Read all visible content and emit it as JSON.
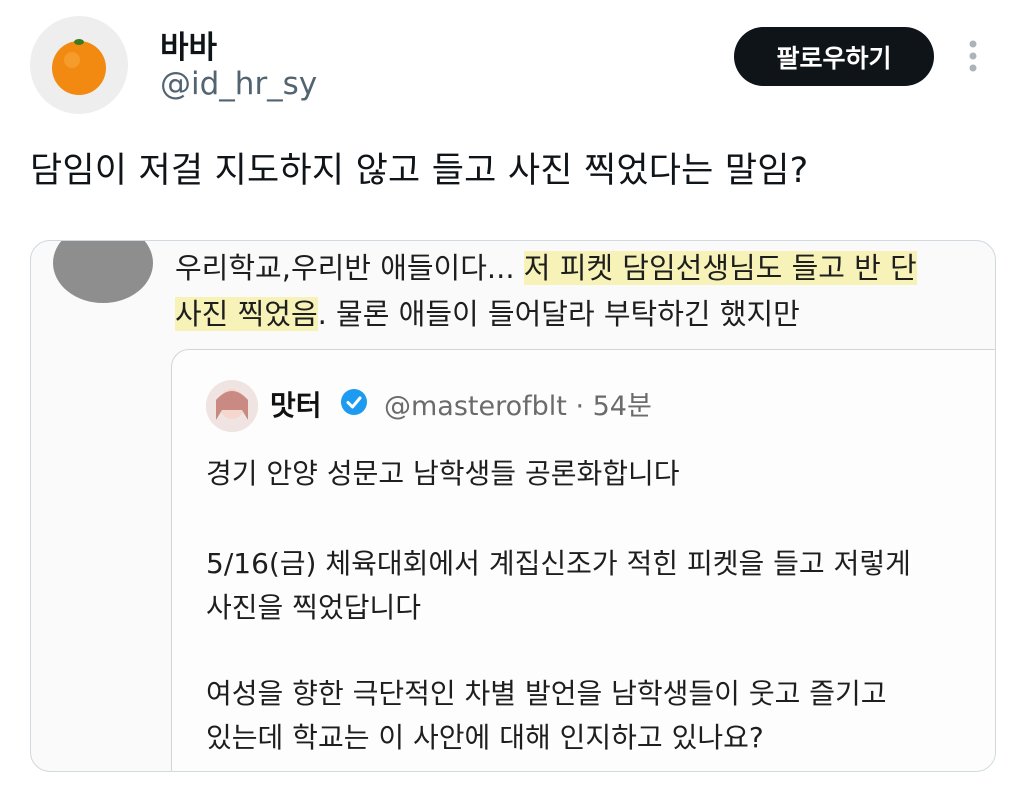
{
  "user": {
    "display_name": "바바",
    "handle": "@id_hr_sy",
    "avatar_icon": "tangerine-avatar"
  },
  "actions": {
    "follow_label": "팔로우하기",
    "more_icon": "more-vertical-icon"
  },
  "tweet": {
    "text": "담임이 저걸 지도하지 않고 들고 사진 찍었다는 말임?"
  },
  "media": {
    "line1_a": "우리학교,우리반 애들이다... ",
    "line1_b": "저 피켓 담임선생님도 들고 반 단",
    "line2_a": "사진 찍었음",
    "line2_b": ". 물론 애들이 들어달라 부탁하긴 했지만",
    "highlight_color": "#f7f2b8",
    "quoted": {
      "name": "맛터",
      "handle": "@masterofblt · 54분",
      "verified_color": "#1d9bf0",
      "line1": "경기 안양 성문고 남학생들 공론화합니다",
      "line2": "5/16(금) 체육대회에서 계집신조가 적힌 피켓을 들고 저렇게",
      "line3": "사진을 찍었답니다",
      "line4": "여성을 향한 극단적인 차별 발언을 남학생들이 웃고 즐기고",
      "line5": "있는데 학교는 이 사안에 대해 인지하고 있나요?"
    }
  }
}
